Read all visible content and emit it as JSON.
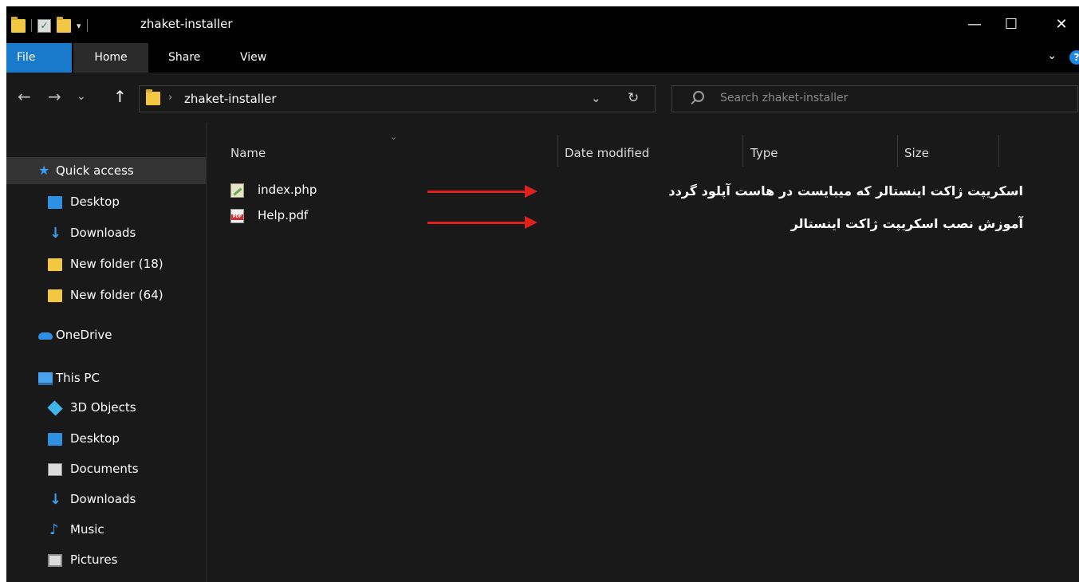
{
  "window": {
    "title": "zhaket-installer",
    "controls": {
      "minimize": "—",
      "maximize": "☐",
      "close": "✕"
    }
  },
  "quick_access_toolbar": {
    "dropdown": "▾"
  },
  "ribbon": {
    "tabs": [
      "File",
      "Home",
      "Share",
      "View"
    ],
    "active_tab": "Home",
    "expand": "⌄",
    "help": "?"
  },
  "address_bar": {
    "path_segment": "zhaket-installer",
    "separator": "›",
    "dropdown": "⌄",
    "refresh": "↻"
  },
  "navigation_buttons": {
    "back": "←",
    "forward": "→",
    "recent": "⌄",
    "up": "↑"
  },
  "search": {
    "placeholder": "Search zhaket-installer"
  },
  "nav_pane": {
    "quick_access": "Quick access",
    "items": [
      "Desktop",
      "Downloads",
      "New folder (18)",
      "New folder (64)"
    ],
    "onedrive": "OneDrive",
    "this_pc": "This PC",
    "pc_items": [
      "3D Objects",
      "Desktop",
      "Documents",
      "Downloads",
      "Music",
      "Pictures"
    ]
  },
  "columns": {
    "name": "Name",
    "date_modified": "Date modified",
    "type": "Type",
    "size": "Size"
  },
  "files": [
    {
      "name": "index.php",
      "icon": "php-file-icon"
    },
    {
      "name": "Help.pdf",
      "icon": "pdf-file-icon"
    }
  ],
  "annotations": [
    "اسکریپت ژاکت اینستالر که میبایست در هاست آپلود گردد",
    "آموزش نصب اسکریپت ژاکت اینستالر"
  ],
  "colors": {
    "accent": "#1979ca",
    "arrow": "#e0201a",
    "background": "#191919"
  }
}
